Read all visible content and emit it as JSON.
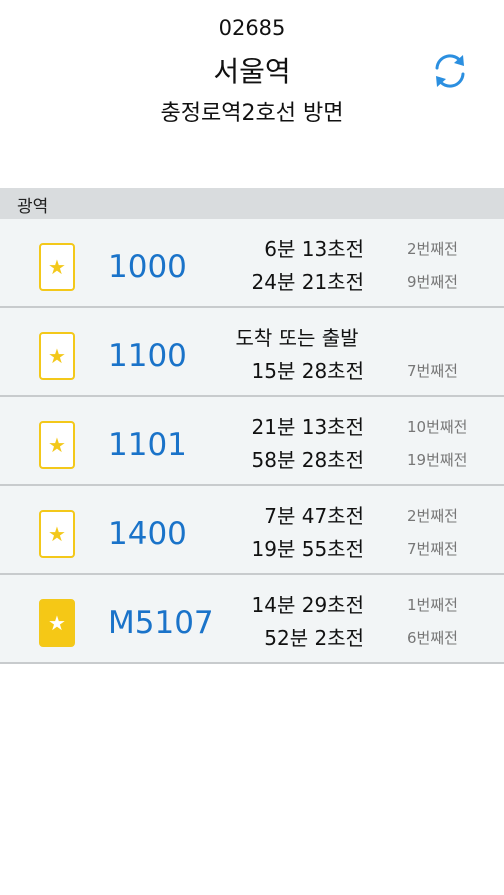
{
  "header": {
    "stop_id": "02685",
    "stop_name": "서울역",
    "direction": "충정로역2호선 방면",
    "refresh_icon": "refresh-icon",
    "accent": "#2b8fe0"
  },
  "section": {
    "title": "광역"
  },
  "buses": [
    {
      "route": "1000",
      "favorite": false,
      "time1": "6분 13초전",
      "count1": "2번째전",
      "time2": "24분 21초전",
      "count2": "9번째전"
    },
    {
      "route": "1100",
      "favorite": false,
      "time1": "도착 또는 출발",
      "count1": "",
      "time2": "15분 28초전",
      "count2": "7번째전"
    },
    {
      "route": "1101",
      "favorite": false,
      "time1": "21분 13초전",
      "count1": "10번째전",
      "time2": "58분 28초전",
      "count2": "19번째전"
    },
    {
      "route": "1400",
      "favorite": false,
      "time1": "7분 47초전",
      "count1": "2번째전",
      "time2": "19분 55초전",
      "count2": "7번째전"
    },
    {
      "route": "M5107",
      "favorite": true,
      "time1": "14분 29초전",
      "count1": "1번째전",
      "time2": "52분  2초전",
      "count2": "6번째전"
    }
  ],
  "colors": {
    "route_blue": "#1a73c9",
    "star_yellow": "#f3c81a",
    "row_bg": "#f2f5f6",
    "section_bg": "#d9dcde"
  }
}
